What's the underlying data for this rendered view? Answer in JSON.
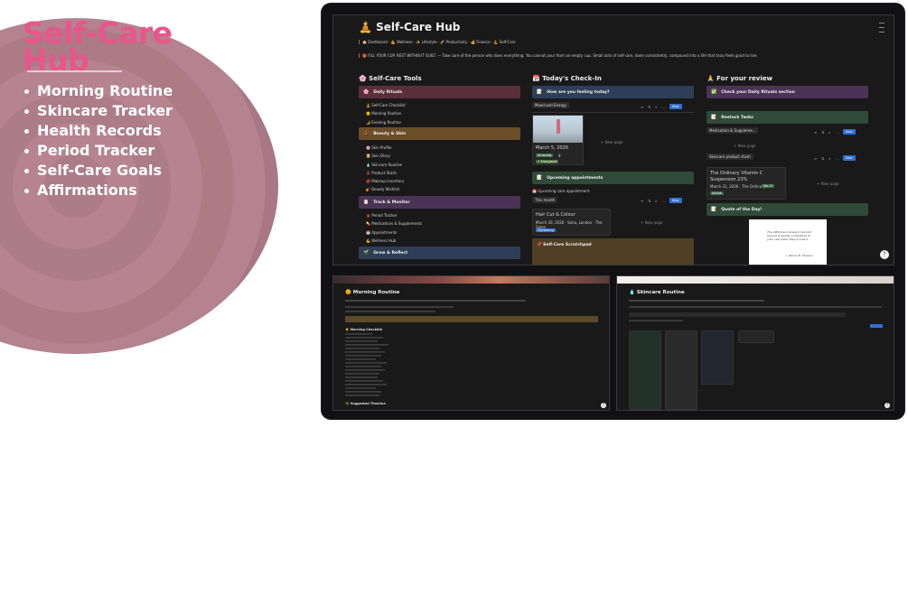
{
  "promo": {
    "title_line1": "Self-Care",
    "title_line2": "Hub",
    "features": [
      "Morning Routine",
      "Skincare Tracker",
      "Health Records",
      "Period Tracker",
      "Self-Care Goals",
      "Affirmations"
    ]
  },
  "main": {
    "title": "Self-Care Hub",
    "title_icon": "🧘",
    "breadcrumb": "🏠 Dashboard · 💪 Wellness · ✨ Lifestyle · 🚀 Productivity · 💰 Finance · 🧘 Self-Care",
    "callout": "🎁 FILL YOUR CUP. REST WITHOUT GUILT. — Take care of the person who does everything. You cannot pour from an empty cup. Small acts of self-care, done consistently, compound into a life that truly feels good to live.",
    "col1": {
      "heading": "🌸 Self-Care Tools",
      "daily_rituals": "Daily Rituals",
      "daily_items": [
        "🧘 Self-Care Checklist",
        "🌞 Morning Routine",
        "🌙 Evening Routine"
      ],
      "beauty": "Beauty & Skin",
      "beauty_items": [
        "🌸 Skin Profile",
        "📔 Skin Diary",
        "🧴 Skincare Routine",
        "💄 Product Stash",
        "💋 Makeup Inventory",
        "💅 Beauty Wishlist"
      ],
      "track": "Track & Monitor",
      "track_items": [
        "🩸 Period Tracker",
        "💊 Medications & Supplements",
        "📅 Appointments",
        "💪 Wellness Hub"
      ],
      "grow": "Grow & Reflect"
    },
    "col2": {
      "heading": "📅 Today's Check-In",
      "feeling": "How are you feeling today?",
      "mood_tab": "Mood and Energy",
      "new_label": "New",
      "entry_date": "March 5, 2026",
      "entry_tag1": "Amazing",
      "entry_tag1_val": "8",
      "entry_tag2": "⚡ Energised",
      "new_page": "+ New page",
      "appointments": "Upcoming appointments",
      "appt_sub": "📅 Upcoming care appointment",
      "this_month": "This month",
      "appt_title": "Hair Cut & Colour",
      "appt_meta": "March 20, 2026 · Soho, London · The Salon",
      "appt_status": "Upcoming",
      "scratchpad": "Self-Care Scratchpad"
    },
    "col3": {
      "heading": "🙏 For your review",
      "check": "Check your Daily Rituals section",
      "restock": "Restock Tasks",
      "restock_chip": "Medication & Suppleme...",
      "stash": "Skincare product stash",
      "product_name": "The Ordinary Vitamin C Suspension 23%",
      "product_meta": "March 31, 2026 · The Ordinary",
      "product_yes": "Yes ☑",
      "product_status": "Active",
      "quote_title": "Quote of the Day!",
      "quote_text": "The difference between hell and heaven is merely a threshold in your own mind. Step across it.",
      "quote_author": "— Simon R. Thomas"
    }
  },
  "shot2": {
    "title": "🌞 Morning Routine",
    "checklist_heading": "☀️ Morning Checklist",
    "timeline_heading": "🌿 Suggested Timeline"
  },
  "shot3": {
    "title": "🧴 Skincare Routine"
  }
}
